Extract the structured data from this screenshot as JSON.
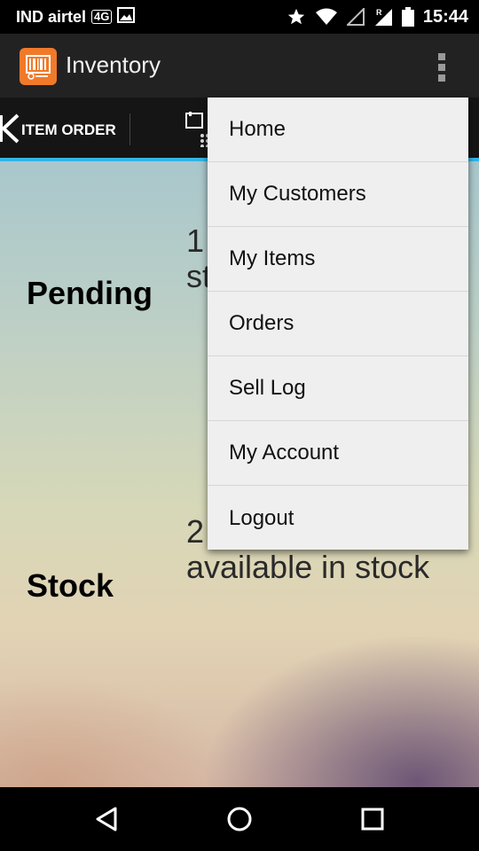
{
  "status_bar": {
    "carrier": "IND airtel",
    "network_badge": "4G",
    "time": "15:44",
    "icons": [
      "image-icon",
      "star-icon",
      "wifi-icon",
      "signal-icon",
      "roaming-signal-icon",
      "battery-icon"
    ]
  },
  "action_bar": {
    "title": "Inventory",
    "logo_icon": "barcode-icon",
    "overflow_icon": "overflow-menu-icon",
    "logo_color": "#f07a2a"
  },
  "tabs": {
    "item_order_label": "ITEM ORDER",
    "indicator_color": "#33b5e5"
  },
  "content": {
    "rows": [
      {
        "label": "Pending",
        "value": "1\nst"
      },
      {
        "label": "Stock",
        "value": "2\navailable in stock"
      }
    ]
  },
  "menu": {
    "items": [
      "Home",
      "My Customers",
      "My Items",
      "Orders",
      "Sell Log",
      "My Account",
      "Logout"
    ]
  },
  "nav_bar": {
    "icons": [
      "back-icon",
      "home-icon",
      "recents-icon"
    ]
  }
}
